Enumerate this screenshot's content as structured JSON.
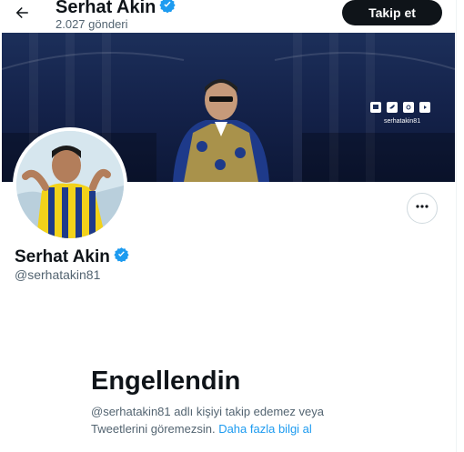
{
  "header": {
    "display_name": "Serhat Akin",
    "post_count": "2.027 gönderi",
    "follow_label": "Takip et"
  },
  "banner": {
    "social_handle": "serhatakin81"
  },
  "profile": {
    "display_name": "Serhat Akin",
    "handle": "@serhatakin81"
  },
  "blocked": {
    "title": "Engellendin",
    "message": "@serhatakin81 adlı kişiyi takip edemez veya Tweetlerini göremezsin.",
    "link": "Daha fazla bilgi al"
  },
  "colors": {
    "verified": "#1d9bf0",
    "button_bg": "#0f1419",
    "secondary_text": "#536471",
    "link": "#1d9bf0"
  },
  "icons": [
    "back-arrow-icon",
    "verified-badge-icon",
    "more-options-icon",
    "twitch-icon",
    "twitter-icon",
    "instagram-icon",
    "youtube-icon"
  ]
}
